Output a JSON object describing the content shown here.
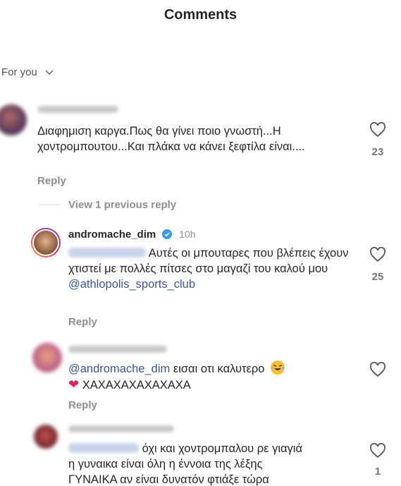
{
  "header": {
    "title": "Comments"
  },
  "filter": {
    "label": "For you"
  },
  "comments": [
    {
      "text": "Διαφημιση καργα.Πως θα γίνει ποιο γνωστή...Η χοντρομπουτου...Και πλάκα να κάνει ξεφτίλα είναι....",
      "reply_label": "Reply",
      "likes": "23"
    },
    {
      "username": "andromache_dim",
      "time": "10h",
      "text": "Αυτές οι μπουταρες που βλέπεις έχουν χτιστεί με πολλές πίτσες στο μαγαζί του καλού μου",
      "mention": "@athlopolis_sports_club",
      "reply_label": "Reply",
      "likes": "25"
    },
    {
      "mention": "@andromache_dim",
      "text": "εισαι οτι καλυτερο",
      "line2": "ΧΑΧΑΧΑΧΑΧΑΧΑΧΑ",
      "reply_label": "Reply"
    },
    {
      "text_line1": "όχι και χοντρομπαλου ρε γιαγιά",
      "text_line2": "η γυναικα είναι όλη η έννοια της λέξης",
      "text_line3": "ΓΥΝΑΙΚΑ αν είναι δυνατόν φτιάξε τώρα",
      "likes": "1"
    }
  ],
  "view_previous": "View 1 previous reply",
  "colors": {
    "link": "#385898",
    "verified": "#3897f0",
    "text": "#262626",
    "muted": "#8e8e8e"
  }
}
